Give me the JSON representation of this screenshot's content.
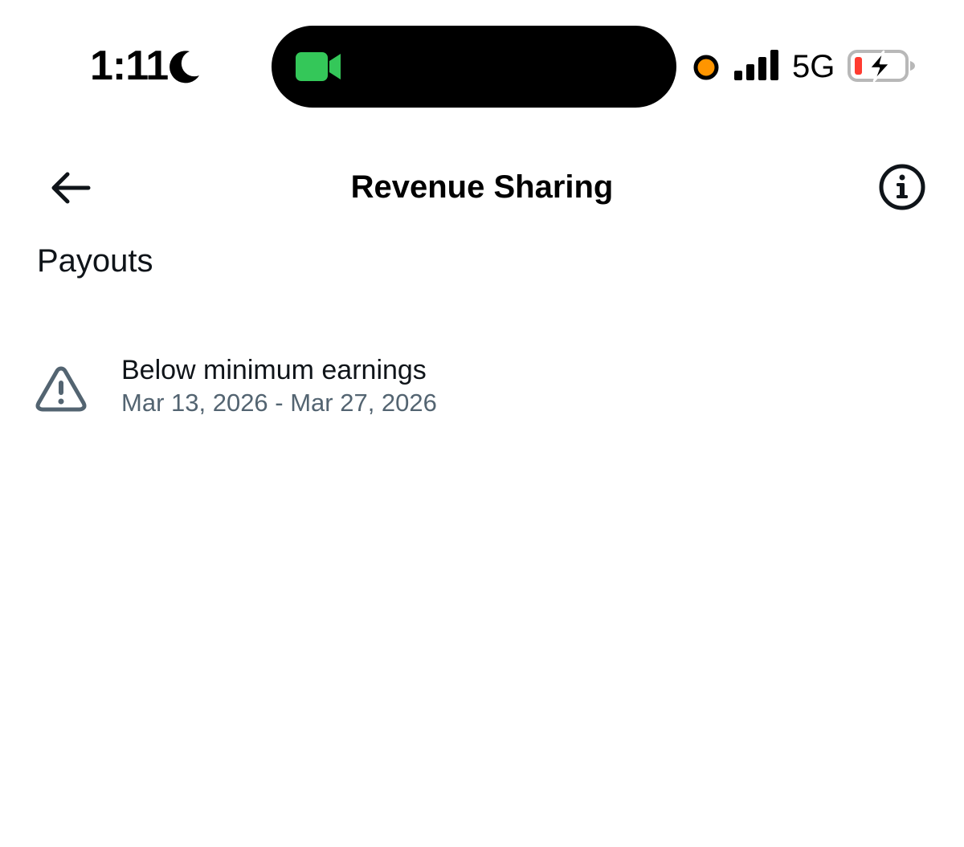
{
  "status_bar": {
    "time": "1:11",
    "network": "5G",
    "icons": {
      "moon": "moon-icon",
      "camera": "video-camera-icon",
      "recording": "recording-indicator-dot",
      "signal": "cellular-signal-icon",
      "battery": "battery-charging-icon"
    },
    "colors": {
      "camera": "#34c759",
      "recording_dot": "#ff9500",
      "battery_low": "#ff3b30"
    }
  },
  "header": {
    "title": "Revenue Sharing",
    "back_icon": "back-arrow-icon",
    "info_icon": "info-icon"
  },
  "payouts": {
    "section_title": "Payouts",
    "items": [
      {
        "icon": "warning-icon",
        "title": "Below minimum earnings",
        "dates": "Mar 13, 2026 - Mar 27, 2026"
      }
    ]
  },
  "colors": {
    "primary_text": "#0f1419",
    "secondary_text": "#536471",
    "background": "#ffffff"
  }
}
